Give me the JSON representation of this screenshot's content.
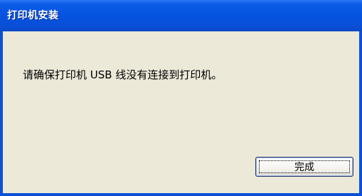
{
  "window": {
    "title": "打印机安装"
  },
  "dialog": {
    "message": "请确保打印机 USB 线没有连接到打印机。",
    "finish_label": "完成"
  },
  "colors": {
    "titlebar": "#0553e0",
    "frame": "#0a4fd6",
    "client_background": "#ece9d8"
  }
}
